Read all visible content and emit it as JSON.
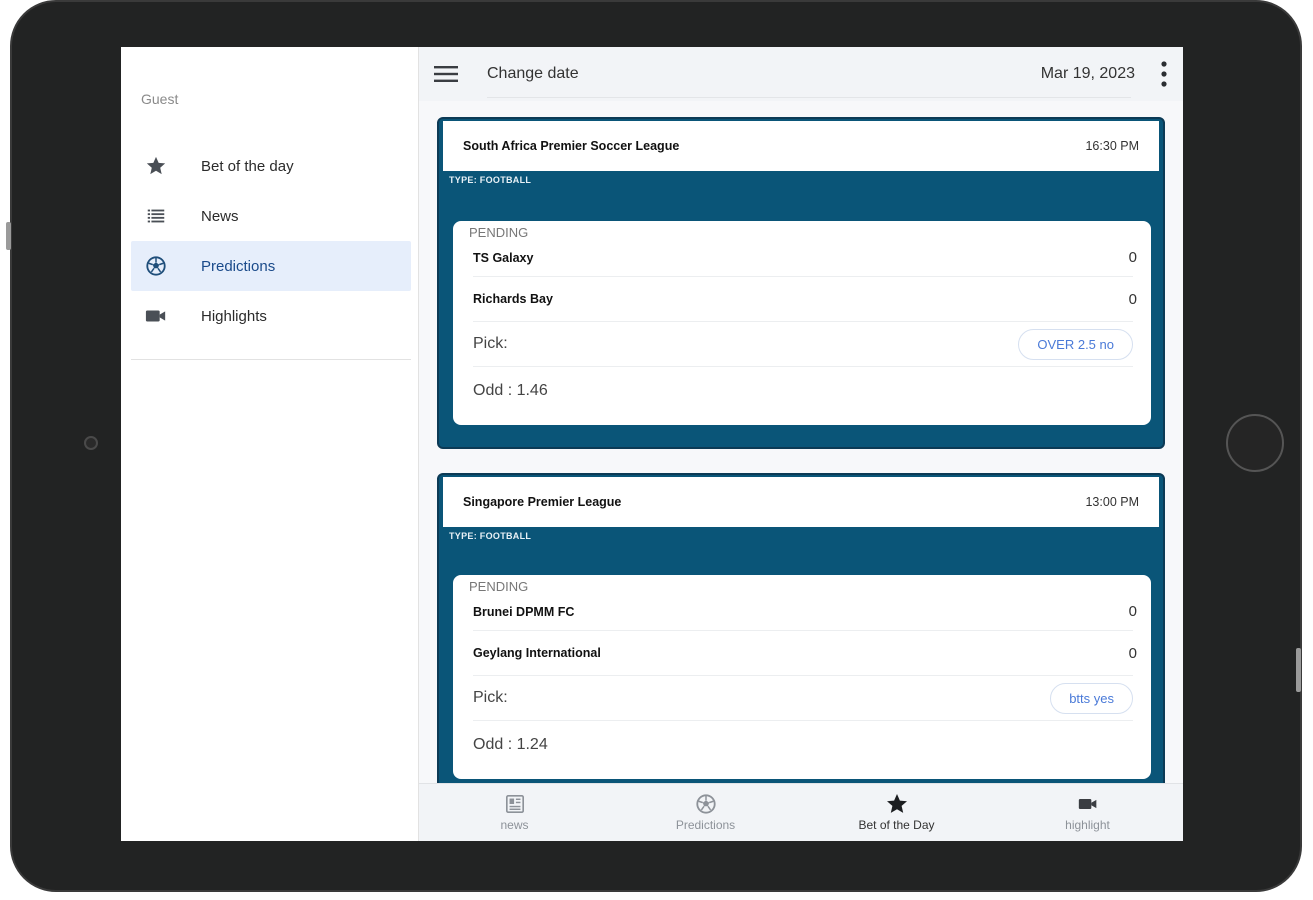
{
  "colors": {
    "accent": "#0a5578",
    "active_bg": "#e6eefb",
    "chip_text": "#4a7ad8"
  },
  "drawer": {
    "user": "Guest",
    "items": [
      {
        "label": "Bet of the day",
        "icon": "star-icon"
      },
      {
        "label": "News",
        "icon": "list-icon"
      },
      {
        "label": "Predictions",
        "icon": "soccer-ball-icon",
        "active": true
      },
      {
        "label": "Highlights",
        "icon": "video-camera-icon"
      }
    ]
  },
  "topbar": {
    "title": "Change date",
    "date": "Mar 19, 2023"
  },
  "matches": [
    {
      "league": "South Africa Premier Soccer League",
      "time": "16:30 PM",
      "type": "TYPE: FOOTBALL",
      "status": "PENDING",
      "home": {
        "team": "TS Galaxy",
        "score": "0"
      },
      "away": {
        "team": "Richards Bay",
        "score": "0"
      },
      "pick_label": "Pick:",
      "pick": "OVER 2.5 no",
      "odd": "Odd : 1.46"
    },
    {
      "league": "Singapore Premier League",
      "time": "13:00 PM",
      "type": "TYPE: FOOTBALL",
      "status": "PENDING",
      "home": {
        "team": "Brunei DPMM FC",
        "score": "0"
      },
      "away": {
        "team": "Geylang International",
        "score": "0"
      },
      "pick_label": "Pick:",
      "pick": "btts yes",
      "odd": "Odd : 1.24"
    }
  ],
  "bottom_nav": [
    {
      "label": "news",
      "icon": "newspaper-icon"
    },
    {
      "label": "Predictions",
      "icon": "soccer-ball-icon"
    },
    {
      "label": "Bet of the Day",
      "icon": "star-icon",
      "selected": true
    },
    {
      "label": "highlight",
      "icon": "video-camera-icon"
    }
  ]
}
